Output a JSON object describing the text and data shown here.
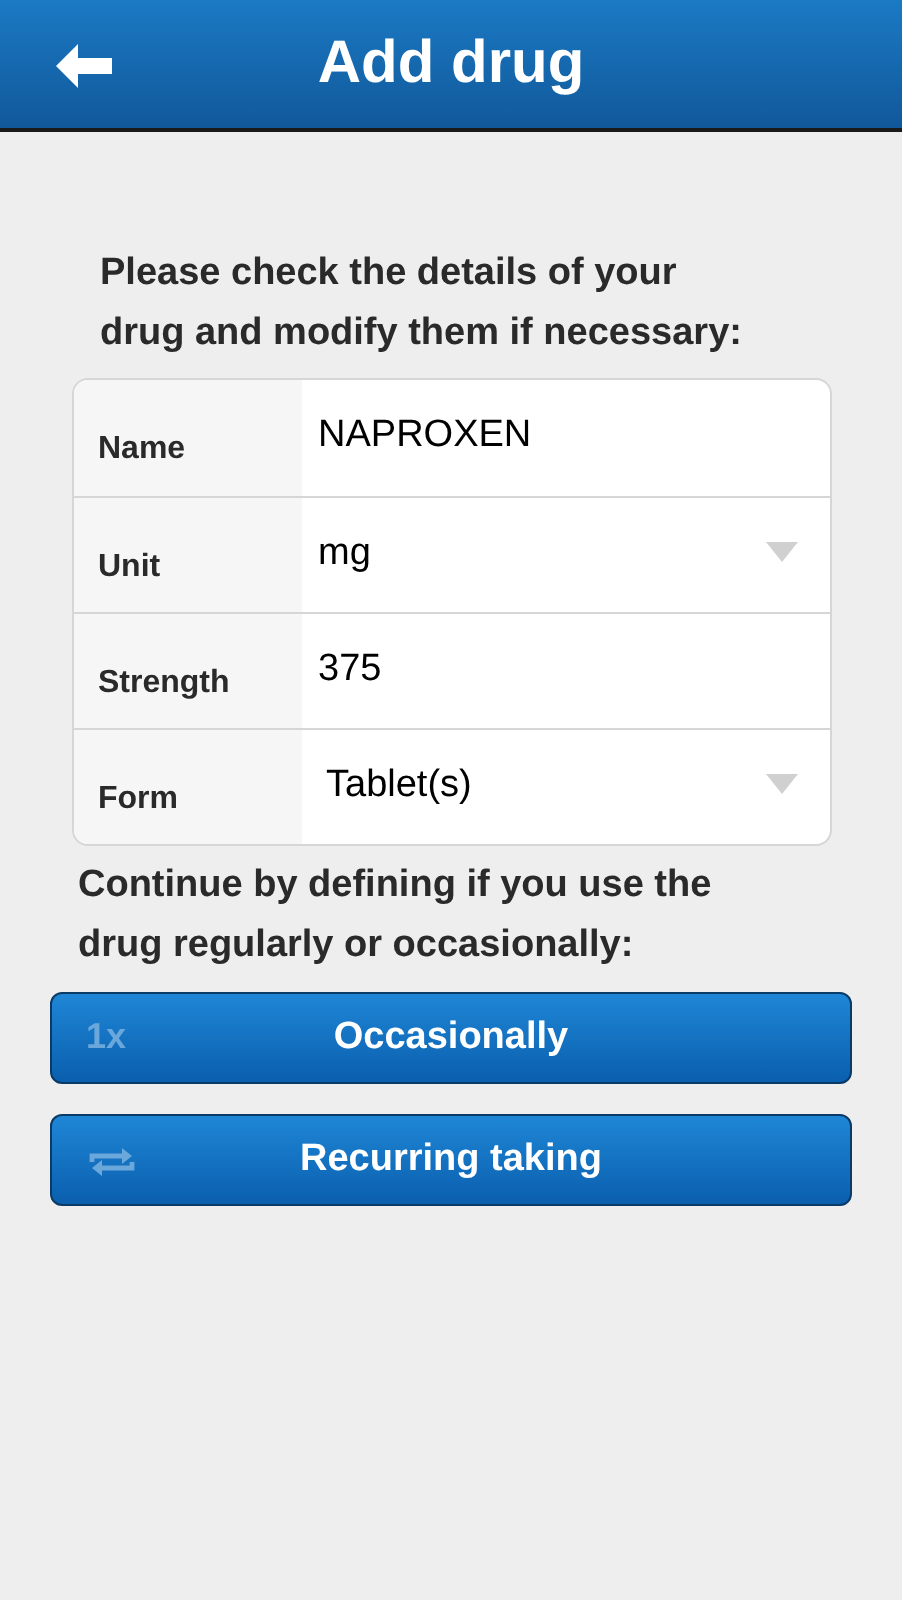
{
  "header": {
    "title": "Add drug"
  },
  "intro": "Please check the details of your drug and modify them if necessary:",
  "fields": [
    {
      "label": "Name",
      "value": "NAPROXEN",
      "kind": "text"
    },
    {
      "label": "Unit",
      "value": "mg",
      "kind": "dropdown"
    },
    {
      "label": "Strength",
      "value": "375",
      "kind": "text"
    },
    {
      "label": "Form",
      "value": "Tablet(s)",
      "kind": "dropdown"
    }
  ],
  "prompt": "Continue by defining if you use the drug regularly or occasionally:",
  "buttons": [
    {
      "label": "Occasionally",
      "kind": "badge",
      "badge": "1x"
    },
    {
      "label": "Recurring taking",
      "kind": "icon"
    }
  ]
}
